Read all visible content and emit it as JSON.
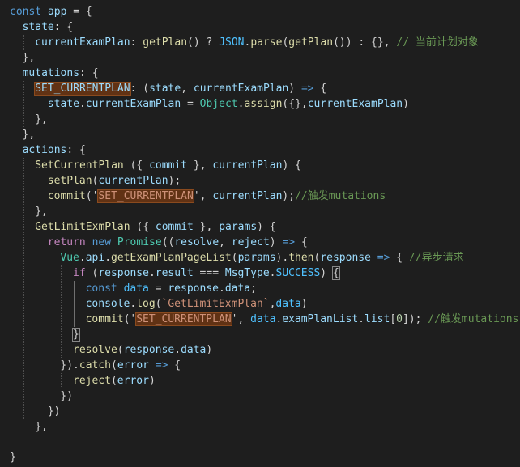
{
  "editor": {
    "language": "javascript",
    "theme_bg": "#1e1e1e",
    "highlight_bg": "#613214",
    "lines": [
      [
        {
          "t": "const",
          "c": "kw"
        },
        {
          "t": " "
        },
        {
          "t": "app",
          "c": "var"
        },
        {
          "t": " = {"
        }
      ],
      [
        {
          "t": "state",
          "c": "var"
        },
        {
          "t": ": {"
        }
      ],
      [
        {
          "t": "currentExamPlan",
          "c": "var"
        },
        {
          "t": ": "
        },
        {
          "t": "getPlan",
          "c": "fn"
        },
        {
          "t": "() ? "
        },
        {
          "t": "JSON",
          "c": "const"
        },
        {
          "t": "."
        },
        {
          "t": "parse",
          "c": "fn"
        },
        {
          "t": "("
        },
        {
          "t": "getPlan",
          "c": "fn"
        },
        {
          "t": "()) : {}, "
        },
        {
          "t": "// 当前计划对象",
          "c": "cmt"
        }
      ],
      [
        {
          "t": "},"
        }
      ],
      [
        {
          "t": "mutations",
          "c": "var"
        },
        {
          "t": ": {"
        }
      ],
      [
        {
          "t": "SET_CURRENTPLAN",
          "c": "var hl"
        },
        {
          "t": ": ("
        },
        {
          "t": "state",
          "c": "var"
        },
        {
          "t": ", "
        },
        {
          "t": "currentExamPlan",
          "c": "var"
        },
        {
          "t": ") "
        },
        {
          "t": "=>",
          "c": "kw"
        },
        {
          "t": " {"
        }
      ],
      [
        {
          "t": "state",
          "c": "var"
        },
        {
          "t": "."
        },
        {
          "t": "currentExamPlan",
          "c": "var"
        },
        {
          "t": " = "
        },
        {
          "t": "Object",
          "c": "cls"
        },
        {
          "t": "."
        },
        {
          "t": "assign",
          "c": "fn"
        },
        {
          "t": "({},"
        },
        {
          "t": "currentExamPlan",
          "c": "var"
        },
        {
          "t": ")"
        }
      ],
      [
        {
          "t": "},"
        }
      ],
      [
        {
          "t": "},"
        }
      ],
      [
        {
          "t": "actions",
          "c": "var"
        },
        {
          "t": ": {"
        }
      ],
      [
        {
          "t": "SetCurrentPlan",
          "c": "fn"
        },
        {
          "t": " ({ "
        },
        {
          "t": "commit",
          "c": "var"
        },
        {
          "t": " }, "
        },
        {
          "t": "currentPlan",
          "c": "var"
        },
        {
          "t": ") {"
        }
      ],
      [
        {
          "t": "setPlan",
          "c": "fn"
        },
        {
          "t": "("
        },
        {
          "t": "currentPlan",
          "c": "var"
        },
        {
          "t": ");"
        }
      ],
      [
        {
          "t": "commit",
          "c": "fn"
        },
        {
          "t": "('"
        },
        {
          "t": "SET_CURRENTPLAN",
          "c": "str hl"
        },
        {
          "t": "', "
        },
        {
          "t": "currentPlan",
          "c": "var"
        },
        {
          "t": ");"
        },
        {
          "t": "//触发mutations",
          "c": "cmt"
        }
      ],
      [
        {
          "t": "},"
        }
      ],
      [
        {
          "t": "GetLimitExmPlan",
          "c": "fn"
        },
        {
          "t": " ({ "
        },
        {
          "t": "commit",
          "c": "var"
        },
        {
          "t": " }, "
        },
        {
          "t": "params",
          "c": "var"
        },
        {
          "t": ") {"
        }
      ],
      [
        {
          "t": "return",
          "c": "ctrl"
        },
        {
          "t": " "
        },
        {
          "t": "new",
          "c": "kw"
        },
        {
          "t": " "
        },
        {
          "t": "Promise",
          "c": "cls"
        },
        {
          "t": "(("
        },
        {
          "t": "resolve",
          "c": "var"
        },
        {
          "t": ", "
        },
        {
          "t": "reject",
          "c": "var"
        },
        {
          "t": ") "
        },
        {
          "t": "=>",
          "c": "kw"
        },
        {
          "t": " {"
        }
      ],
      [
        {
          "t": "Vue",
          "c": "cls"
        },
        {
          "t": "."
        },
        {
          "t": "api",
          "c": "var"
        },
        {
          "t": "."
        },
        {
          "t": "getExamPlanPageList",
          "c": "fn"
        },
        {
          "t": "("
        },
        {
          "t": "params",
          "c": "var"
        },
        {
          "t": ")."
        },
        {
          "t": "then",
          "c": "fn"
        },
        {
          "t": "("
        },
        {
          "t": "response",
          "c": "var"
        },
        {
          "t": " "
        },
        {
          "t": "=>",
          "c": "kw"
        },
        {
          "t": " { "
        },
        {
          "t": "//异步请求",
          "c": "cmt"
        }
      ],
      [
        {
          "t": "if",
          "c": "ctrl"
        },
        {
          "t": " ("
        },
        {
          "t": "response",
          "c": "var"
        },
        {
          "t": "."
        },
        {
          "t": "result",
          "c": "var"
        },
        {
          "t": " === "
        },
        {
          "t": "MsgType",
          "c": "var"
        },
        {
          "t": "."
        },
        {
          "t": "SUCCESS",
          "c": "const"
        },
        {
          "t": ") "
        },
        {
          "t": "{",
          "c": "bracket-match"
        }
      ],
      [
        {
          "t": "const",
          "c": "kw"
        },
        {
          "t": " "
        },
        {
          "t": "data",
          "c": "const"
        },
        {
          "t": " = "
        },
        {
          "t": "response",
          "c": "var"
        },
        {
          "t": "."
        },
        {
          "t": "data",
          "c": "var"
        },
        {
          "t": ";"
        }
      ],
      [
        {
          "t": "console",
          "c": "var"
        },
        {
          "t": "."
        },
        {
          "t": "log",
          "c": "fn"
        },
        {
          "t": "("
        },
        {
          "t": "`GetLimitExmPlan`",
          "c": "str"
        },
        {
          "t": ","
        },
        {
          "t": "data",
          "c": "const"
        },
        {
          "t": ")"
        }
      ],
      [
        {
          "t": "commit",
          "c": "fn"
        },
        {
          "t": "('"
        },
        {
          "t": "SET_CURRENTPLAN",
          "c": "str hl"
        },
        {
          "t": "', "
        },
        {
          "t": "data",
          "c": "const"
        },
        {
          "t": "."
        },
        {
          "t": "examPlanList",
          "c": "var"
        },
        {
          "t": "."
        },
        {
          "t": "list",
          "c": "var"
        },
        {
          "t": "["
        },
        {
          "t": "0",
          "c": "num"
        },
        {
          "t": "]); "
        },
        {
          "t": "//触发mutations",
          "c": "cmt"
        }
      ],
      [
        {
          "t": "}",
          "c": "bracket-match"
        }
      ],
      [
        {
          "t": "resolve",
          "c": "fn"
        },
        {
          "t": "("
        },
        {
          "t": "response",
          "c": "var"
        },
        {
          "t": "."
        },
        {
          "t": "data",
          "c": "var"
        },
        {
          "t": ")"
        }
      ],
      [
        {
          "t": "})."
        },
        {
          "t": "catch",
          "c": "fn"
        },
        {
          "t": "("
        },
        {
          "t": "error",
          "c": "var"
        },
        {
          "t": " "
        },
        {
          "t": "=>",
          "c": "kw"
        },
        {
          "t": " {"
        }
      ],
      [
        {
          "t": "reject",
          "c": "fn"
        },
        {
          "t": "("
        },
        {
          "t": "error",
          "c": "var"
        },
        {
          "t": ")"
        }
      ],
      [
        {
          "t": "})"
        }
      ],
      [
        {
          "t": "})"
        }
      ],
      [
        {
          "t": "},"
        }
      ],
      [],
      [
        {
          "t": "}"
        }
      ]
    ]
  }
}
